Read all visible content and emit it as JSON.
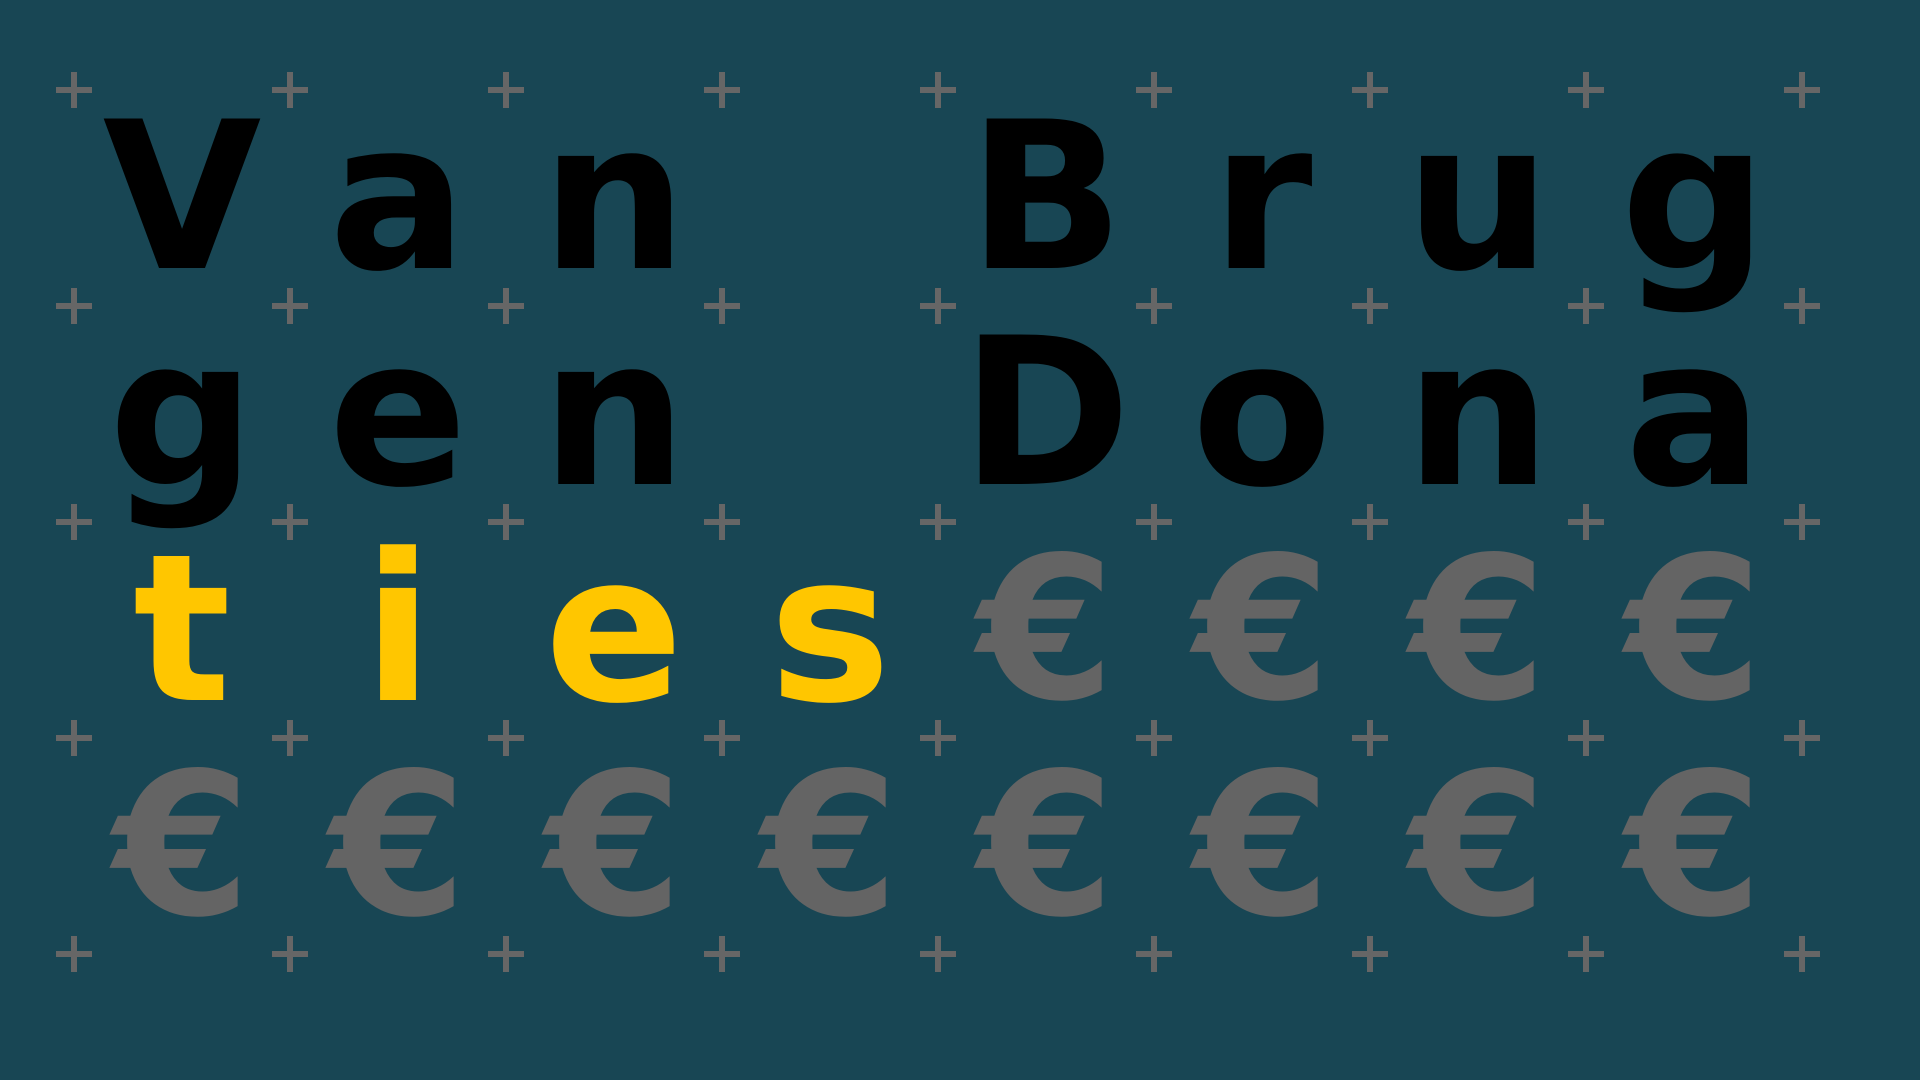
{
  "banner": {
    "title": "Van Bruggen Donaties",
    "background_color": "#184654"
  },
  "grid": {
    "columns": 8,
    "rows": 4,
    "marker": "plus-icon",
    "marker_color": "#666666"
  },
  "cells": [
    {
      "char": "V",
      "color": "#000000",
      "kind": "letter"
    },
    {
      "char": "a",
      "color": "#000000",
      "kind": "letter"
    },
    {
      "char": "n",
      "color": "#000000",
      "kind": "letter"
    },
    {
      "char": " ",
      "color": "#000000",
      "kind": "space"
    },
    {
      "char": "B",
      "color": "#000000",
      "kind": "letter"
    },
    {
      "char": "r",
      "color": "#000000",
      "kind": "letter"
    },
    {
      "char": "u",
      "color": "#000000",
      "kind": "letter"
    },
    {
      "char": "g",
      "color": "#000000",
      "kind": "letter"
    },
    {
      "char": "g",
      "color": "#000000",
      "kind": "letter"
    },
    {
      "char": "e",
      "color": "#000000",
      "kind": "letter"
    },
    {
      "char": "n",
      "color": "#000000",
      "kind": "letter"
    },
    {
      "char": " ",
      "color": "#000000",
      "kind": "space"
    },
    {
      "char": "D",
      "color": "#000000",
      "kind": "letter"
    },
    {
      "char": "o",
      "color": "#000000",
      "kind": "letter"
    },
    {
      "char": "n",
      "color": "#000000",
      "kind": "letter"
    },
    {
      "char": "a",
      "color": "#000000",
      "kind": "letter"
    },
    {
      "char": "t",
      "color": "#FFC600",
      "kind": "letter"
    },
    {
      "char": "i",
      "color": "#FFC600",
      "kind": "letter"
    },
    {
      "char": "e",
      "color": "#FFC600",
      "kind": "letter"
    },
    {
      "char": "s",
      "color": "#FFC600",
      "kind": "letter"
    },
    {
      "char": "€",
      "color": "#646464",
      "kind": "euro"
    },
    {
      "char": "€",
      "color": "#646464",
      "kind": "euro"
    },
    {
      "char": "€",
      "color": "#646464",
      "kind": "euro"
    },
    {
      "char": "€",
      "color": "#646464",
      "kind": "euro"
    },
    {
      "char": "€",
      "color": "#646464",
      "kind": "euro"
    },
    {
      "char": "€",
      "color": "#646464",
      "kind": "euro"
    },
    {
      "char": "€",
      "color": "#646464",
      "kind": "euro"
    },
    {
      "char": "€",
      "color": "#646464",
      "kind": "euro"
    },
    {
      "char": "€",
      "color": "#646464",
      "kind": "euro"
    },
    {
      "char": "€",
      "color": "#646464",
      "kind": "euro"
    },
    {
      "char": "€",
      "color": "#646464",
      "kind": "euro"
    },
    {
      "char": "€",
      "color": "#646464",
      "kind": "euro"
    }
  ]
}
